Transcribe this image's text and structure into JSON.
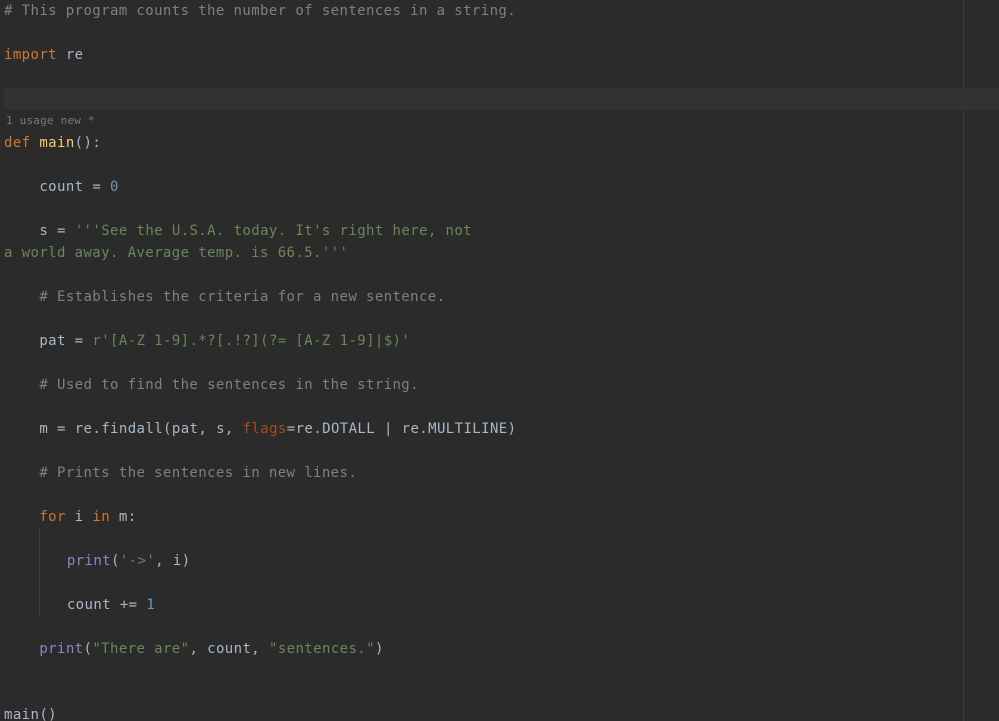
{
  "hints": {
    "usage": "1 usage",
    "author": "new *"
  },
  "code": {
    "l1_comment": "# This program counts the number of sentences in a string.",
    "l2_import": "import",
    "l2_mod": "re",
    "l3_def": "def",
    "l3_name": "main",
    "l3_parens": "()",
    "l3_colon": ":",
    "l4_lhs": "count",
    "l4_eq": "=",
    "l4_val": "0",
    "l5_lhs": "s",
    "l5_eq": "=",
    "l5_str1": "'''See the U.S.A. today. It's right here, not",
    "l5_str2": "a world away. Average temp. is 66.5.'''",
    "l6_comment": "# Establishes the criteria for a new sentence.",
    "l7_lhs": "pat",
    "l7_eq": "=",
    "l7_prefix": "r",
    "l7_str": "'[A-Z 1-9].*?[.!?](?= [A-Z 1-9]|$)'",
    "l8_comment": "# Used to find the sentences in the string.",
    "l9_lhs": "m",
    "l9_eq": "=",
    "l9_re": "re",
    "l9_findall": "findall",
    "l9_pat": "pat",
    "l9_s": "s",
    "l9_flags": "flags",
    "l9_dotall": "DOTALL",
    "l9_mline": "MULTILINE",
    "l10_comment": "# Prints the sentences in new lines.",
    "l11_for": "for",
    "l11_i": "i",
    "l11_in": "in",
    "l11_m": "m",
    "l11_colon": ":",
    "l12_print": "print",
    "l12_arrow": "'->'",
    "l12_i": "i",
    "l13_count": "count",
    "l13_pluseq": "+=",
    "l13_one": "1",
    "l14_print": "print",
    "l14_s1": "\"There are\"",
    "l14_count": "count",
    "l14_s2": "\"sentences.\"",
    "l15_main": "main",
    "l15_parens": "()"
  }
}
